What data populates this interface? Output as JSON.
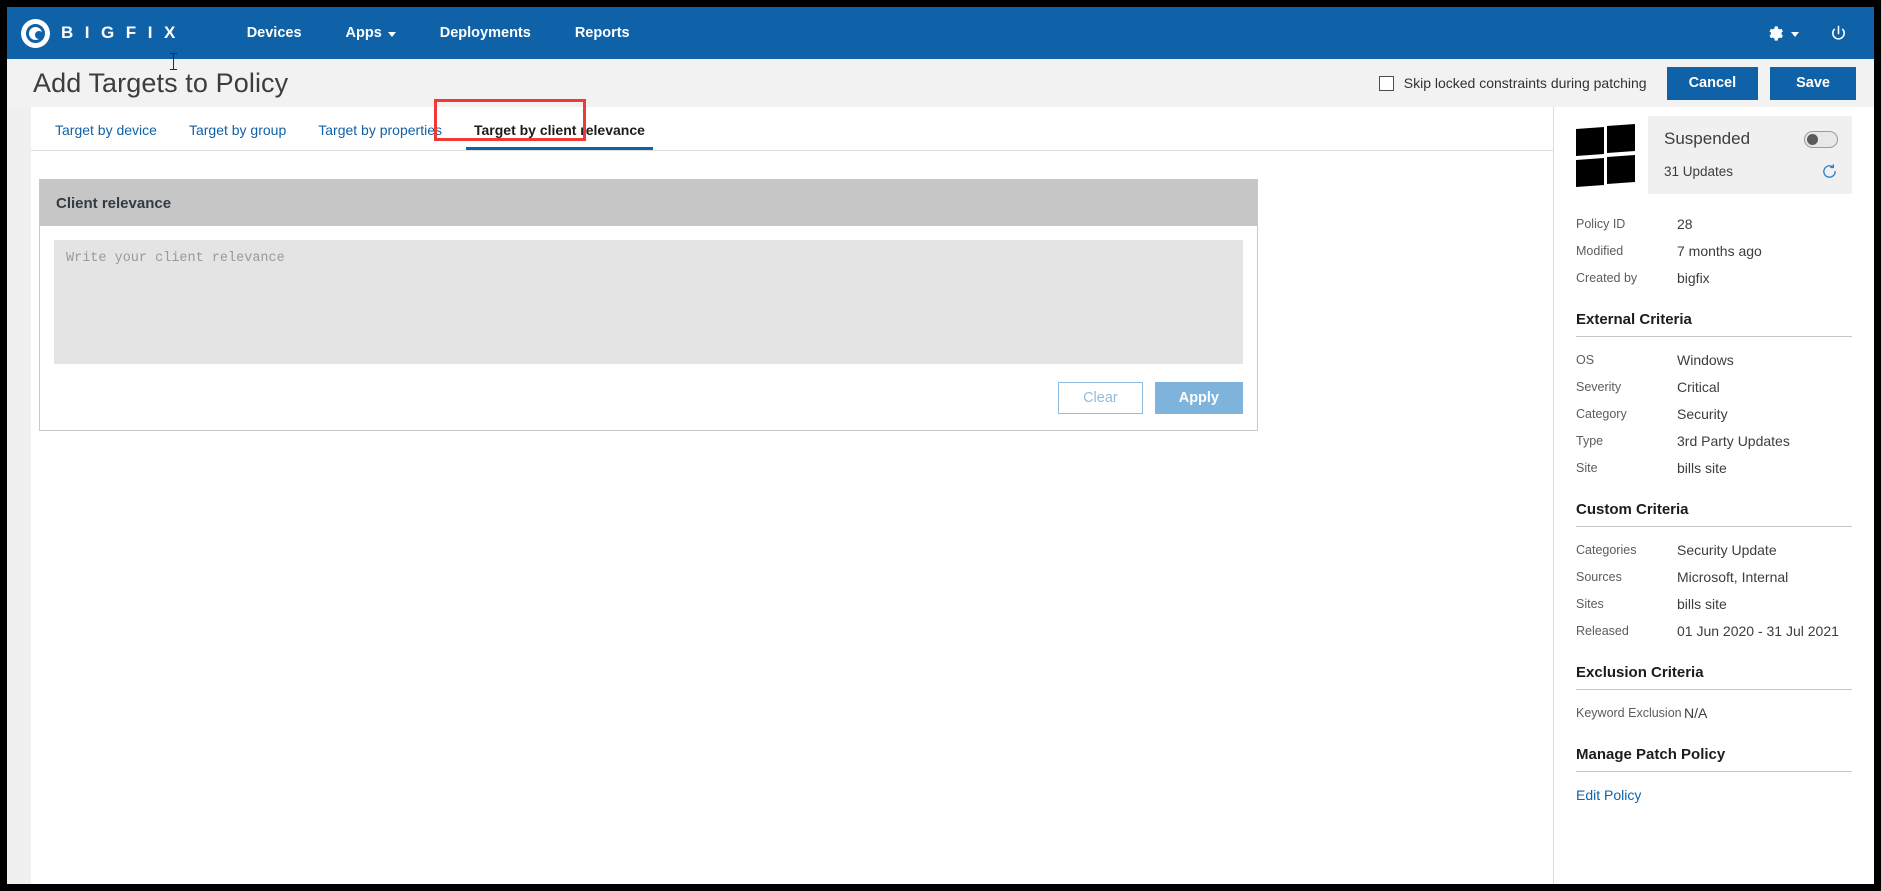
{
  "topnav": {
    "brand": "B I G F I X",
    "links": [
      {
        "label": "Devices",
        "caret": false
      },
      {
        "label": "Apps",
        "caret": true
      },
      {
        "label": "Deployments",
        "caret": false
      },
      {
        "label": "Reports",
        "caret": false
      }
    ],
    "settings_icon": "gear-icon",
    "power_icon": "power-icon",
    "accent": "#0f62a8"
  },
  "header": {
    "title": "Add Targets to Policy",
    "skip_locked_label": "Skip locked constraints during patching",
    "skip_locked_checked": false,
    "cancel_label": "Cancel",
    "save_label": "Save"
  },
  "tabs": [
    {
      "label": "Target by device",
      "active": false
    },
    {
      "label": "Target by group",
      "active": false
    },
    {
      "label": "Target by properties",
      "active": false
    },
    {
      "label": "Target by client relevance",
      "active": true
    }
  ],
  "card": {
    "title": "Client relevance",
    "textarea_value": "",
    "textarea_placeholder": "Write your client relevance",
    "clear_label": "Clear",
    "apply_label": "Apply"
  },
  "sidepanel": {
    "os_icon": "windows-logo-icon",
    "status": "Suspended",
    "toggle_on": false,
    "updates": "31 Updates",
    "refresh_icon": "refresh-icon",
    "meta": [
      {
        "key": "Policy ID",
        "value": "28"
      },
      {
        "key": "Modified",
        "value": "7 months ago"
      },
      {
        "key": "Created by",
        "value": "bigfix"
      }
    ],
    "external_criteria": {
      "title": "External Criteria",
      "rows": [
        {
          "key": "OS",
          "value": "Windows"
        },
        {
          "key": "Severity",
          "value": "Critical"
        },
        {
          "key": "Category",
          "value": "Security"
        },
        {
          "key": "Type",
          "value": "3rd Party Updates"
        },
        {
          "key": "Site",
          "value": "bills site"
        }
      ]
    },
    "custom_criteria": {
      "title": "Custom Criteria",
      "rows": [
        {
          "key": "Categories",
          "value": "Security Update"
        },
        {
          "key": "Sources",
          "value": "Microsoft, Internal"
        },
        {
          "key": "Sites",
          "value": "bills site"
        },
        {
          "key": "Released",
          "value": "01 Jun 2020 - 31 Jul 2021"
        }
      ]
    },
    "exclusion_criteria": {
      "title": "Exclusion Criteria",
      "rows": [
        {
          "key": "Keyword Exclusion",
          "value": "N/A"
        }
      ]
    },
    "manage_patch_policy": {
      "title": "Manage Patch Policy",
      "edit_link": "Edit Policy"
    }
  }
}
